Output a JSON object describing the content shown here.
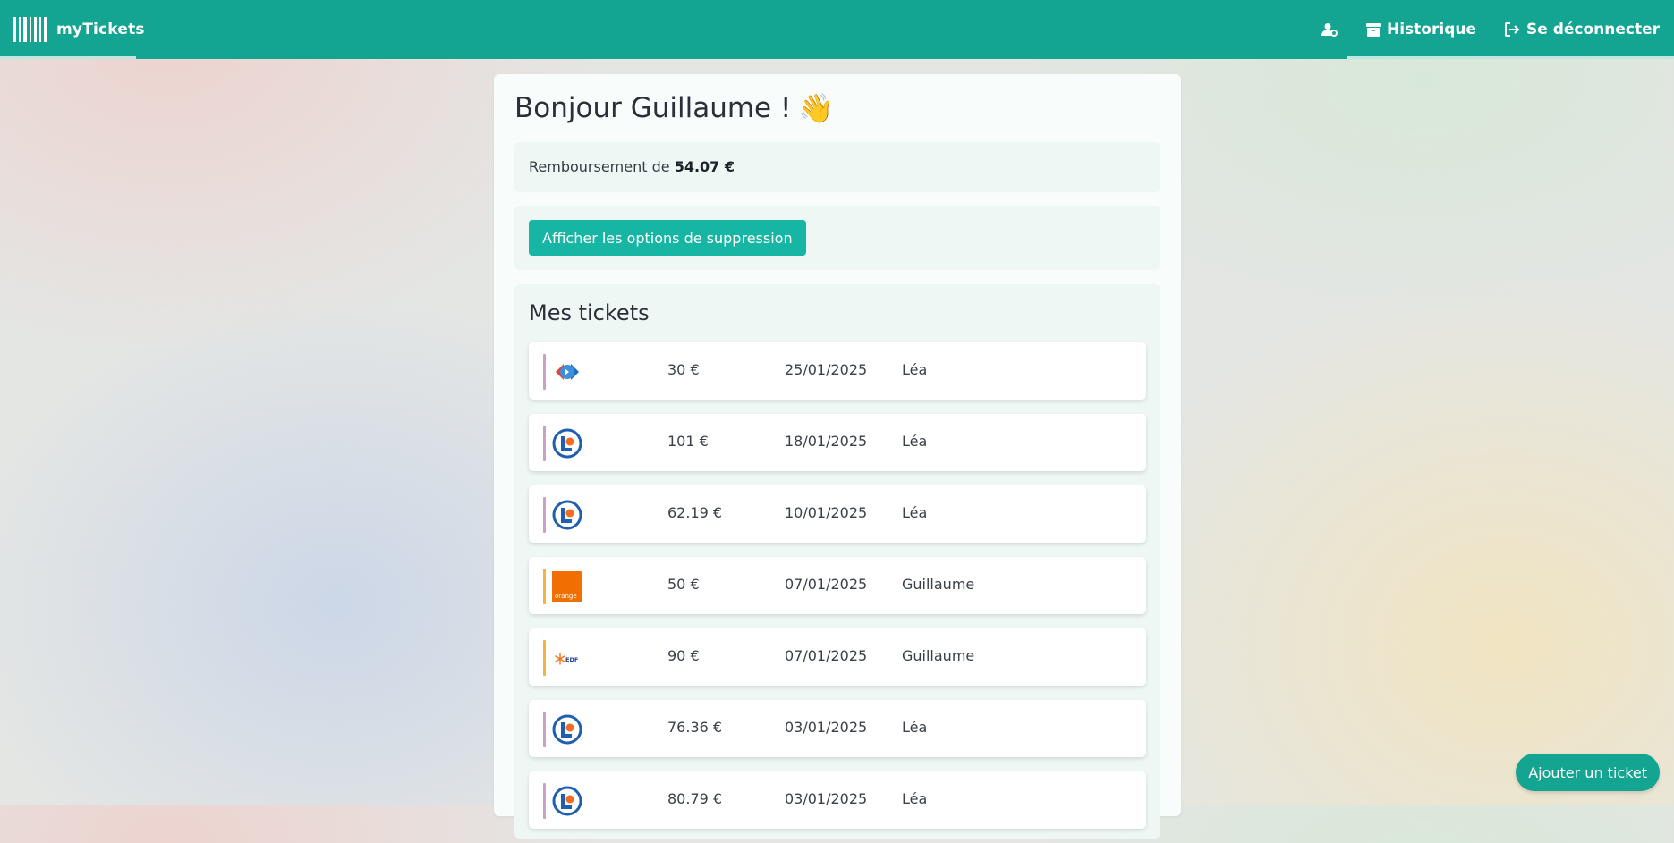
{
  "app": {
    "brand": "myTickets"
  },
  "nav": {
    "profile_icon": "user-cog-icon",
    "history_label": "Historique",
    "logout_label": "Se déconnecter"
  },
  "greeting": {
    "text": "Bonjour Guillaume !",
    "emoji": "👋"
  },
  "refund": {
    "prefix": "Remboursement de",
    "amount": "54.07 €"
  },
  "actions": {
    "show_delete_options": "Afficher les options de suppression"
  },
  "tickets": {
    "title": "Mes tickets",
    "items": [
      {
        "logo": "carrefour-logo",
        "amount": "30 €",
        "date": "25/01/2025",
        "person": "Léa",
        "accent": "#c9a0c6"
      },
      {
        "logo": "leclerc-logo",
        "amount": "101 €",
        "date": "18/01/2025",
        "person": "Léa",
        "accent": "#c9a0c6"
      },
      {
        "logo": "leclerc-logo",
        "amount": "62.19 €",
        "date": "10/01/2025",
        "person": "Léa",
        "accent": "#c9a0c6"
      },
      {
        "logo": "orange-logo",
        "logo_text": "orange",
        "amount": "50 €",
        "date": "07/01/2025",
        "person": "Guillaume",
        "accent": "#f4b33c"
      },
      {
        "logo": "edf-logo",
        "logo_text": "EDF",
        "amount": "90 €",
        "date": "07/01/2025",
        "person": "Guillaume",
        "accent": "#f4b33c"
      },
      {
        "logo": "leclerc-logo",
        "amount": "76.36 €",
        "date": "03/01/2025",
        "person": "Léa",
        "accent": "#c9a0c6"
      },
      {
        "logo": "leclerc-logo",
        "amount": "80.79 €",
        "date": "03/01/2025",
        "person": "Léa",
        "accent": "#c9a0c6"
      }
    ]
  },
  "fab": {
    "label": "Ajouter un ticket"
  },
  "colors": {
    "primary": "#13a592",
    "button": "#17b5a3"
  }
}
